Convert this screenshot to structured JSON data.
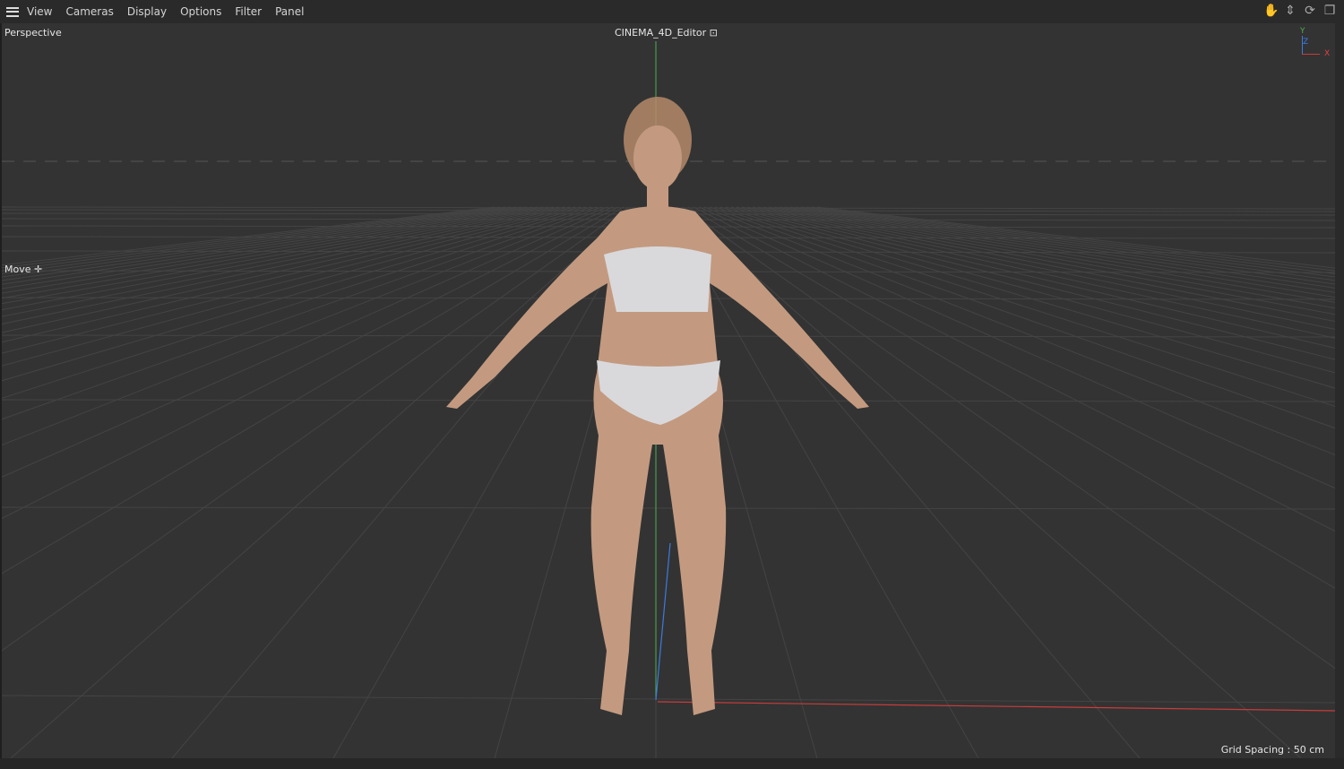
{
  "menu": {
    "items": [
      "View",
      "Cameras",
      "Display",
      "Options",
      "Filter",
      "Panel"
    ]
  },
  "nav_icons": [
    "hand-pan-icon",
    "move-arrows-icon",
    "rotate-icon",
    "maximize-icon"
  ],
  "viewport": {
    "camera_label": "Perspective",
    "camera_name": "CINEMA_4D_Editor",
    "tool_label": "Move",
    "grid_spacing": "Grid Spacing : 50 cm"
  },
  "axes": {
    "y": "Y",
    "z": "Z",
    "x": "X"
  },
  "colors": {
    "x_axis": "#c83c3c",
    "y_axis": "#4caf50",
    "z_axis": "#3b7be0",
    "skin": "#c39a80",
    "garment": "#d9d9dc"
  }
}
